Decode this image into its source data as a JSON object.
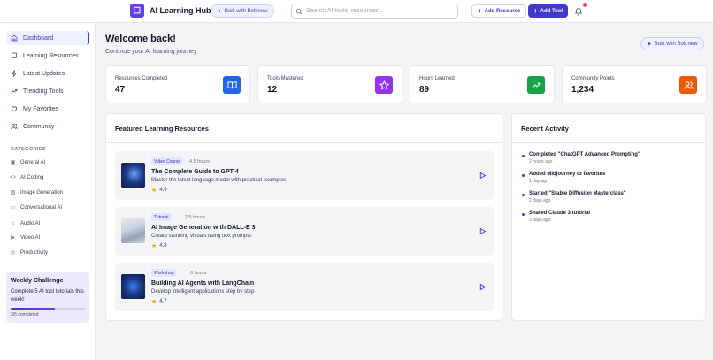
{
  "header": {
    "app_title": "AI Learning Hub",
    "built_with": "Built with Bolt.new",
    "search_placeholder": "Search AI tools, resources...",
    "search_value": "",
    "add_resource": "Add Resource",
    "add_tool": "Add Tool",
    "has_notification": true
  },
  "sidebar": {
    "nav": [
      {
        "label": "Dashboard",
        "icon": "home-icon",
        "active": true
      },
      {
        "label": "Learning Resources",
        "icon": "book-icon",
        "active": false
      },
      {
        "label": "Latest Updates",
        "icon": "zap-icon",
        "active": false
      },
      {
        "label": "Trending Tools",
        "icon": "trending-up-icon",
        "active": false
      },
      {
        "label": "My Favorites",
        "icon": "heart-icon",
        "active": false
      },
      {
        "label": "Community",
        "icon": "users-icon",
        "active": false
      }
    ],
    "categories_heading": "CATEGORIES",
    "categories": [
      {
        "label": "General AI",
        "icon": "chip-icon"
      },
      {
        "label": "AI Coding",
        "icon": "code-icon"
      },
      {
        "label": "Image Generation",
        "icon": "image-icon"
      },
      {
        "label": "Conversational AI",
        "icon": "chat-icon"
      },
      {
        "label": "Audio AI",
        "icon": "music-icon"
      },
      {
        "label": "Video AI",
        "icon": "video-icon"
      },
      {
        "label": "Productivity",
        "icon": "target-icon"
      }
    ],
    "challenge": {
      "title": "Weekly Challenge",
      "description": "Complete 5 AI tool tutorials this week!",
      "progress_label": "3/5 completed",
      "progress_fraction": 0.6
    }
  },
  "main": {
    "welcome_title": "Welcome back!",
    "welcome_subtitle": "Continue your AI learning journey",
    "built_with": "Built with Bolt.new",
    "stats": [
      {
        "label": "Resources Completed",
        "value": "47",
        "icon": "book-open-icon",
        "color": "#2563eb"
      },
      {
        "label": "Tools Mastered",
        "value": "12",
        "icon": "star-icon",
        "color": "#9333ea"
      },
      {
        "label": "Hours Learned",
        "value": "89",
        "icon": "trending-up-icon",
        "color": "#16a34a"
      },
      {
        "label": "Community Points",
        "value": "1,234",
        "icon": "users-icon",
        "color": "#ea580c"
      }
    ],
    "featured": {
      "title": "Featured Learning Resources",
      "items": [
        {
          "badge": "Video Course",
          "duration": "4.5 hours",
          "title": "The Complete Guide to GPT-4",
          "description": "Master the latest language model with practical examples",
          "rating": "4.9"
        },
        {
          "badge": "Tutorial",
          "duration": "2.5 hours",
          "title": "AI Image Generation with DALL-E 3",
          "description": "Create stunning visuals using text prompts",
          "rating": "4.8"
        },
        {
          "badge": "Workshop",
          "duration": "6 hours",
          "title": "Building AI Agents with LangChain",
          "description": "Develop intelligent applications step by step",
          "rating": "4.7"
        }
      ]
    },
    "activity": {
      "title": "Recent Activity",
      "items": [
        {
          "text": "Completed \"ChatGPT Advanced Prompting\"",
          "time": "2 hours ago"
        },
        {
          "text": "Added Midjourney to favorites",
          "time": "1 day ago"
        },
        {
          "text": "Started \"Stable Diffusion Masterclass\"",
          "time": "2 days ago"
        },
        {
          "text": "Shared Claude 3 tutorial",
          "time": "3 days ago"
        }
      ]
    }
  }
}
